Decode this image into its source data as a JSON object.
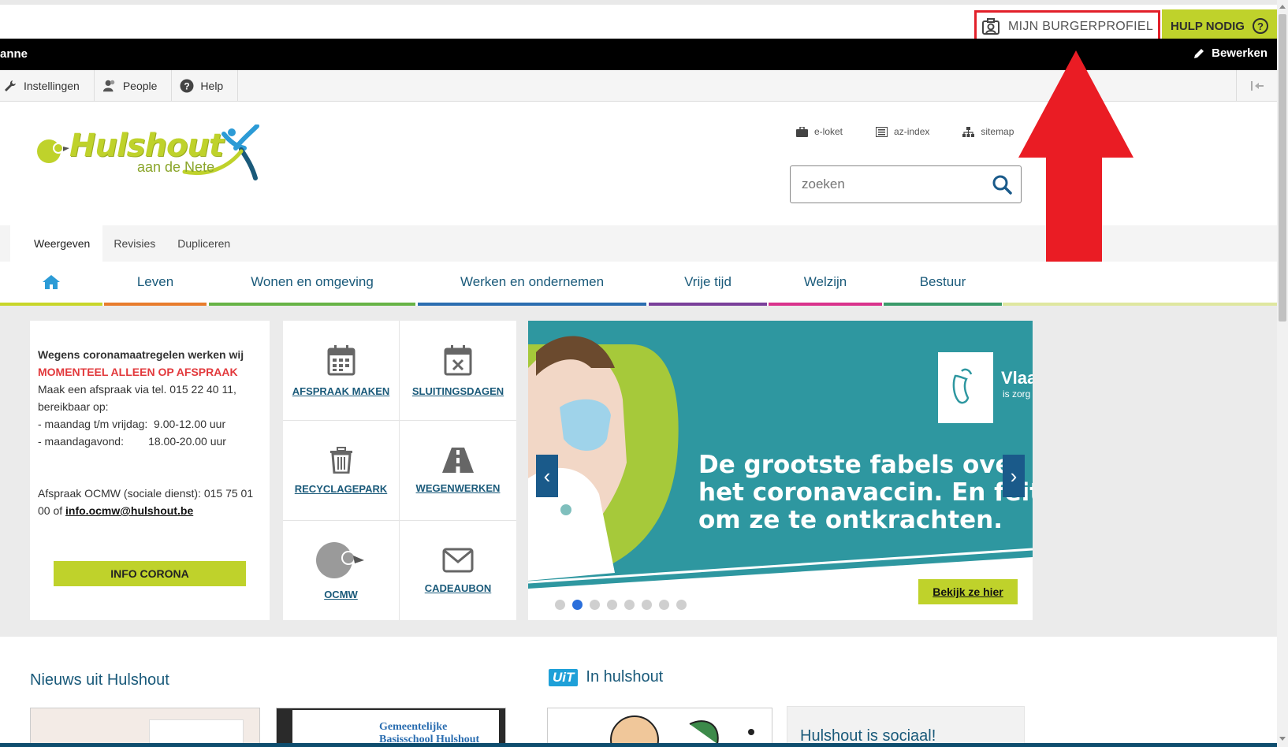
{
  "topbar": {
    "profile_label": "MIJN BURGERPROFIEL",
    "help_label": "HULP NODIG",
    "help_icon_glyph": "?"
  },
  "adminbar": {
    "user": "anne",
    "edit_label": "Bewerken"
  },
  "toolbar": {
    "items": [
      {
        "label": "Instellingen",
        "icon": "wrench-icon"
      },
      {
        "label": "People",
        "icon": "people-icon"
      },
      {
        "label": "Help",
        "icon": "help-icon"
      }
    ]
  },
  "header": {
    "logo_name": "Hulshout",
    "logo_sub": "aan de Nete",
    "quick_links": [
      "e-loket",
      "az-index",
      "sitemap"
    ],
    "search_placeholder": "zoeken"
  },
  "tabs": [
    "Weergeven",
    "Revisies",
    "Dupliceren"
  ],
  "nav": {
    "home_icon": "home-icon",
    "items": [
      "Leven",
      "Wonen en omgeving",
      "Werken en ondernemen",
      "Vrije tijd",
      "Welzijn",
      "Bestuur"
    ],
    "colors": [
      "#e87c2c",
      "#67b346",
      "#2b6db0",
      "#7a3f9a",
      "#d9338c",
      "#3a9a6a"
    ]
  },
  "corona": {
    "title": "Wegens coronamaatregelen werken wij",
    "highlight": "MOMENTEEL ALLEEN OP AFSPRAAK",
    "line1": "Maak een afspraak via tel. 015 22 40 11,",
    "line2": "bereikbaar op:",
    "line3": "- maandag t/m vrijdag:  9.00-12.00 uur",
    "line4": "- maandagavond:        18.00-20.00 uur",
    "ocmw_prefix": "Afspraak OCMW (sociale dienst): 015 75 01 00 of ",
    "ocmw_email": "info.ocmw@hulshout.be",
    "button": "INFO CORONA"
  },
  "tiles": [
    {
      "label": "AFSPRAAK MAKEN",
      "icon": "calendar-icon"
    },
    {
      "label": "SLUITINGSDAGEN",
      "icon": "calendar-x-icon"
    },
    {
      "label": "RECYCLAGEPARK",
      "icon": "trash-icon"
    },
    {
      "label": "WEGENWERKEN",
      "icon": "road-icon"
    },
    {
      "label": "OCMW",
      "icon": "ocmw-logo-icon"
    },
    {
      "label": "CADEAUBON",
      "icon": "envelope-icon"
    }
  ],
  "carousel": {
    "headline_1": "De grootste fabels over",
    "headline_2": "het coronavaccin. En feite",
    "headline_3": "om ze te ontkrachten.",
    "flag_text": "Vlaa",
    "flag_sub": "is zorg",
    "cta": "Bekijk ze hier",
    "prev": "‹",
    "next": "›",
    "slide_count": 8,
    "active_slide": 2
  },
  "bottom": {
    "news_title": "Nieuws uit Hulshout",
    "uit_badge": "UiT",
    "uit_title": "In hulshout",
    "social_title": "Hulshout is sociaal!",
    "school_card": "Gemeentelijke Basisschool Hulshout"
  }
}
